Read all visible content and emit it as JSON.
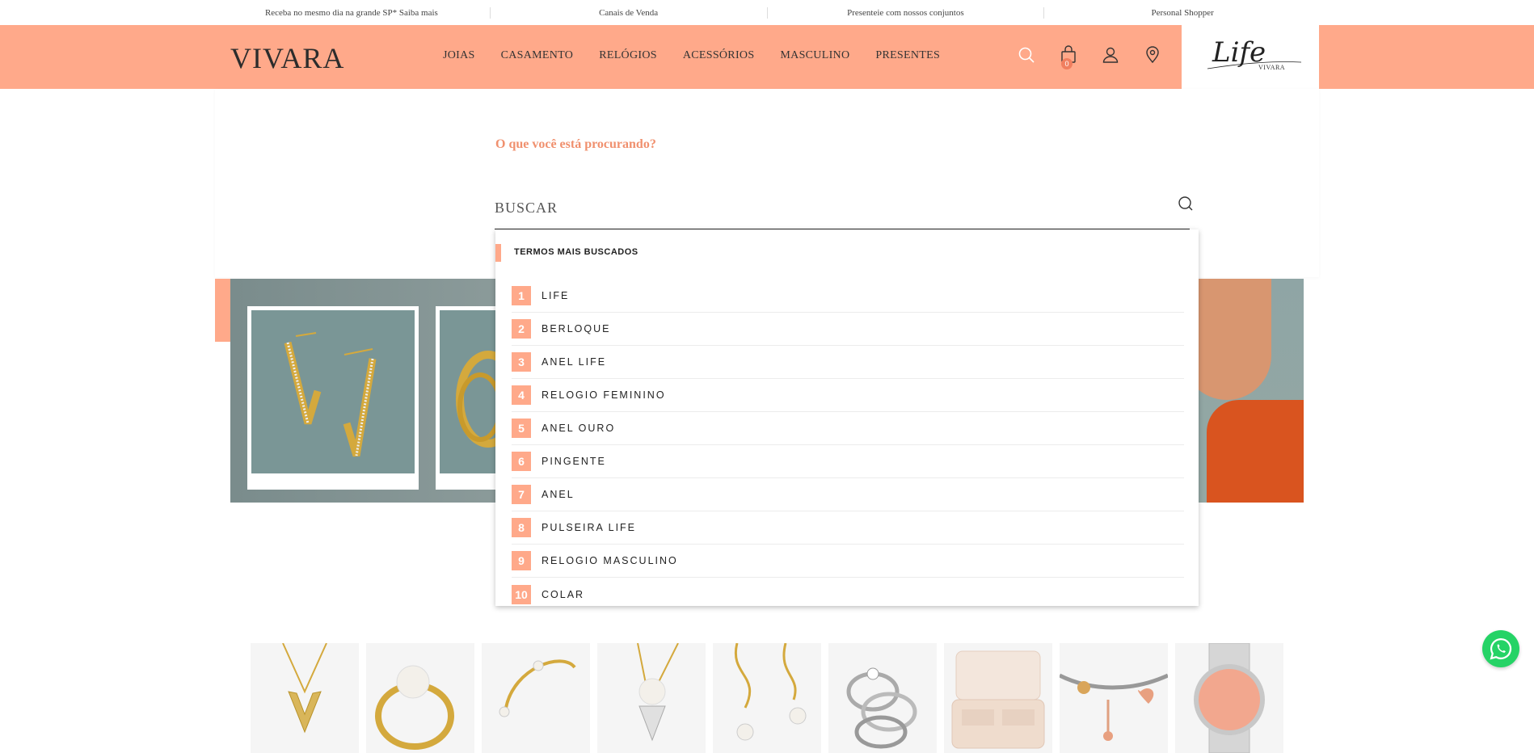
{
  "topbar": {
    "items": [
      "Receba no mesmo dia na grande SP* Saiba mais",
      "Canais de Venda",
      "Presenteie com nossos conjuntos",
      "Personal Shopper"
    ]
  },
  "header": {
    "logo": "VIVARA",
    "nav": [
      "JOIAS",
      "CASAMENTO",
      "RELÓGIOS",
      "ACESSÓRIOS",
      "MASCULINO",
      "PRESENTES"
    ],
    "cart_count": "0",
    "icons": [
      "search-icon",
      "bag-icon",
      "user-icon",
      "location-pin-icon"
    ],
    "life_logo": "Life",
    "life_sub": "VIVARA"
  },
  "search": {
    "question": "O que você está procurando?",
    "placeholder": "BUSCAR",
    "value": ""
  },
  "suggestions": {
    "title": "TERMOS MAIS BUSCADOS",
    "items": [
      {
        "num": "1",
        "label": "LIFE"
      },
      {
        "num": "2",
        "label": "BERLOQUE"
      },
      {
        "num": "3",
        "label": "ANEL LIFE"
      },
      {
        "num": "4",
        "label": "RELOGIO FEMININO"
      },
      {
        "num": "5",
        "label": "ANEL OURO"
      },
      {
        "num": "6",
        "label": "PINGENTE"
      },
      {
        "num": "7",
        "label": "ANEL"
      },
      {
        "num": "8",
        "label": "PULSEIRA LIFE"
      },
      {
        "num": "9",
        "label": "RELOGIO MASCULINO"
      },
      {
        "num": "10",
        "label": "COLAR"
      }
    ]
  },
  "colors": {
    "brand": "#ffa98a",
    "accent_text": "#f0906e",
    "whatsapp": "#25d366"
  }
}
